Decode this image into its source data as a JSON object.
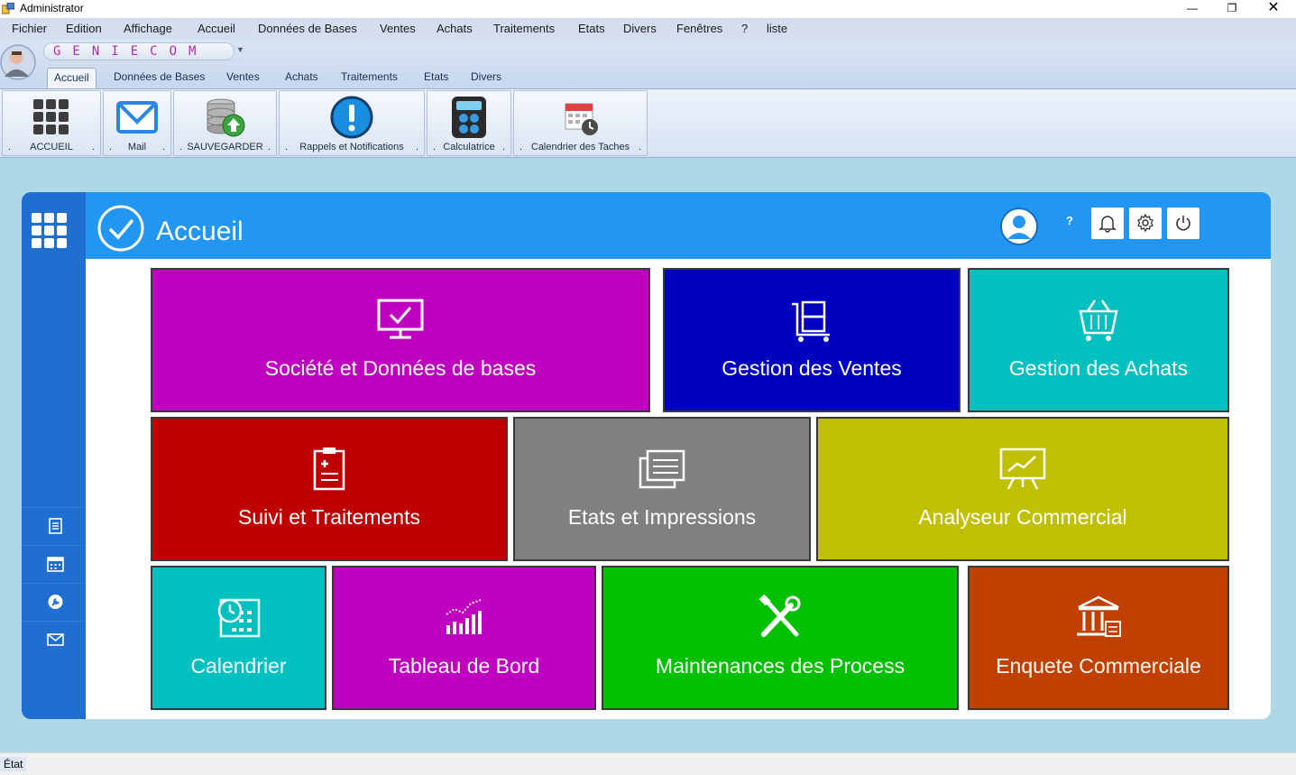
{
  "window": {
    "title": "Administrator"
  },
  "menu": [
    "Fichier",
    "Edition",
    "Affichage",
    "Accueil",
    "Données de Bases",
    "Ventes",
    "Achats",
    "Traitements",
    "Etats",
    "Divers",
    "Fenêtres",
    "?",
    "liste"
  ],
  "brand": "GENIECOM",
  "ribbon": {
    "tabs": [
      "Accueil",
      "Données de Bases",
      "Ventes",
      "Achats",
      "Traitements",
      "Etats",
      "Divers"
    ],
    "active_tab": "Accueil",
    "buttons": [
      {
        "label": "ACCUEIL",
        "icon": "grid-icon"
      },
      {
        "label": "Mail",
        "icon": "mail-icon"
      },
      {
        "label": "SAUVEGARDER",
        "icon": "database-save-icon"
      },
      {
        "label": "Rappels et Notifications",
        "icon": "exclamation-icon"
      },
      {
        "label": "Calculatrice",
        "icon": "calculator-icon"
      },
      {
        "label": "Calendrier des Taches",
        "icon": "calendar-clock-icon"
      }
    ],
    "separator": "."
  },
  "dashboard": {
    "title": "Accueil",
    "help": "?",
    "tiles": [
      {
        "label": "Société et Données de bases",
        "color": "#c000c0",
        "icon": "monitor-check-icon"
      },
      {
        "label": "Gestion des Ventes",
        "color": "#0000c0",
        "icon": "cart-boxes-icon"
      },
      {
        "label": "Gestion des Achats",
        "color": "#00c0c0",
        "icon": "basket-icon"
      },
      {
        "label": "Suivi et Traitements",
        "color": "#c00000",
        "icon": "clipboard-icon"
      },
      {
        "label": "Etats et Impressions",
        "color": "#808080",
        "icon": "documents-icon"
      },
      {
        "label": "Analyseur Commercial",
        "color": "#c0c000",
        "icon": "presentation-chart-icon"
      },
      {
        "label": "Calendrier",
        "color": "#00c0c0",
        "icon": "calendar-clock-icon"
      },
      {
        "label": "Tableau de Bord",
        "color": "#c000c0",
        "icon": "bar-chart-icon"
      },
      {
        "label": "Maintenances des Process",
        "color": "#00c000",
        "icon": "tools-icon"
      },
      {
        "label": "Enquete Commerciale",
        "color": "#c04000",
        "icon": "bank-icon"
      }
    ]
  },
  "status": "État"
}
